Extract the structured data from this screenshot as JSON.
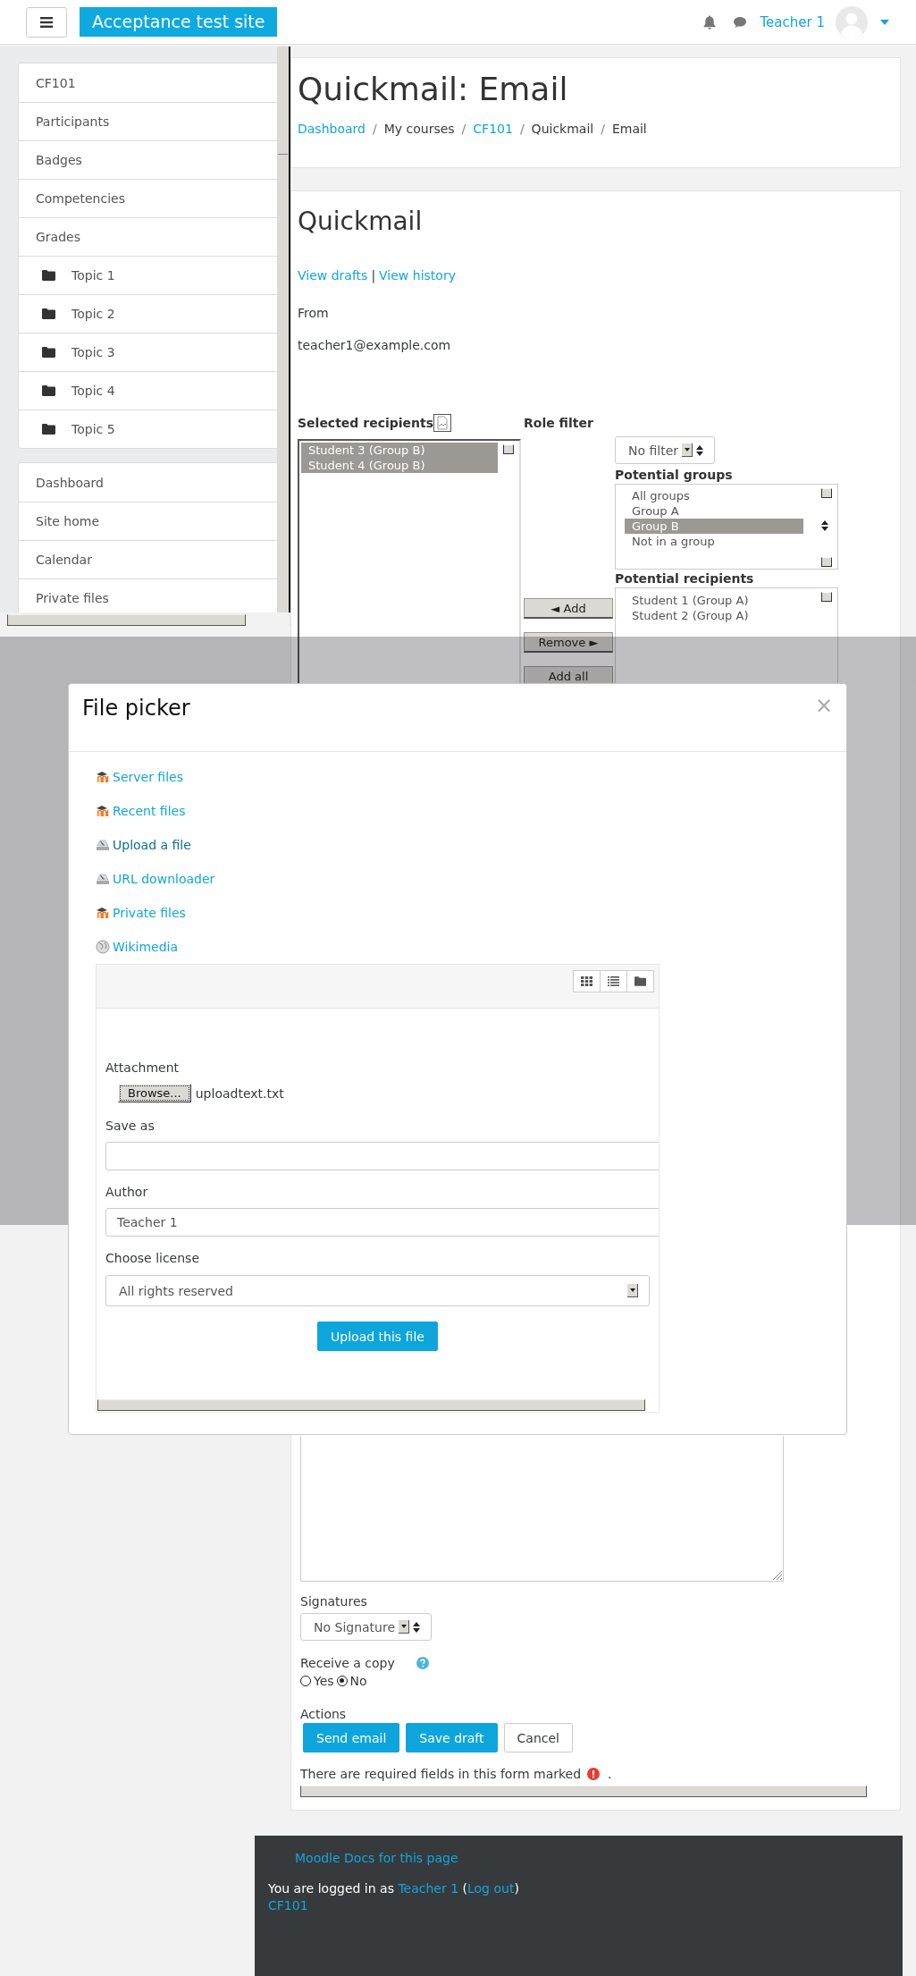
{
  "navbar": {
    "site_name": "Acceptance test site",
    "user_name": "Teacher 1"
  },
  "sidebar": {
    "sections": [
      {
        "items": [
          {
            "label": "CF101",
            "kind": "link"
          },
          {
            "label": "Participants",
            "kind": "link"
          },
          {
            "label": "Badges",
            "kind": "link"
          },
          {
            "label": "Competencies",
            "kind": "link"
          },
          {
            "label": "Grades",
            "kind": "link"
          },
          {
            "label": "Topic 1",
            "kind": "folder"
          },
          {
            "label": "Topic 2",
            "kind": "folder"
          },
          {
            "label": "Topic 3",
            "kind": "folder"
          },
          {
            "label": "Topic 4",
            "kind": "folder"
          },
          {
            "label": "Topic 5",
            "kind": "folder"
          }
        ]
      },
      {
        "items": [
          {
            "label": "Dashboard",
            "kind": "link"
          },
          {
            "label": "Site home",
            "kind": "link"
          },
          {
            "label": "Calendar",
            "kind": "link"
          },
          {
            "label": "Private files",
            "kind": "link"
          }
        ]
      }
    ]
  },
  "header": {
    "title": "Quickmail: Email",
    "breadcrumb": [
      {
        "label": "Dashboard",
        "link": true
      },
      {
        "label": "My courses",
        "link": false
      },
      {
        "label": "CF101",
        "link": true
      },
      {
        "label": "Quickmail",
        "link": false
      },
      {
        "label": "Email",
        "link": false
      }
    ],
    "separator": "/"
  },
  "form": {
    "title": "Quickmail",
    "links": [
      "View drafts",
      "View history"
    ],
    "link_separator": "|",
    "from_label": "From",
    "from_value": "teacher1@example.com",
    "selected_recipients": {
      "label": "Selected recipients",
      "items": [
        {
          "label": "Student 3 (Group B)",
          "selected": true
        },
        {
          "label": "Student 4 (Group B)",
          "selected": true
        }
      ]
    },
    "role_filter": {
      "label": "Role filter",
      "value": "No filter"
    },
    "potential_groups": {
      "label": "Potential groups",
      "items": [
        {
          "label": "All groups",
          "selected": false
        },
        {
          "label": "Group A",
          "selected": false
        },
        {
          "label": "Group B",
          "selected": true
        },
        {
          "label": "Not in a group",
          "selected": false
        }
      ]
    },
    "potential_recipients": {
      "label": "Potential recipients",
      "items": [
        {
          "label": "Student 1 (Group A)",
          "selected": false
        },
        {
          "label": "Student 2 (Group A)",
          "selected": false
        }
      ]
    },
    "move_buttons": [
      "◄ Add",
      "Remove ►",
      "Add all"
    ],
    "signatures": {
      "label": "Signatures",
      "value": "No Signature"
    },
    "receive_copy": {
      "label": "Receive a copy",
      "options": [
        {
          "label": "Yes",
          "selected": false
        },
        {
          "label": "No",
          "selected": true
        }
      ]
    },
    "actions": {
      "label": "Actions",
      "buttons": [
        {
          "label": "Send email",
          "kind": "primary"
        },
        {
          "label": "Save draft",
          "kind": "primary"
        },
        {
          "label": "Cancel",
          "kind": "secondary"
        }
      ]
    },
    "required_note": "There are required fields in this form marked",
    "required_note_end": "."
  },
  "file_picker": {
    "title": "File picker",
    "close": "×",
    "repositories": [
      {
        "label": "Server files",
        "kind": "moodle",
        "selected": false
      },
      {
        "label": "Recent files",
        "kind": "moodle",
        "selected": false
      },
      {
        "label": "Upload a file",
        "kind": "upload",
        "selected": true
      },
      {
        "label": "URL downloader",
        "kind": "upload",
        "selected": false
      },
      {
        "label": "Private files",
        "kind": "moodle",
        "selected": false
      },
      {
        "label": "Wikimedia",
        "kind": "globe",
        "selected": false
      }
    ],
    "attachment_label": "Attachment",
    "browse_button": "Browse...",
    "file_name": "uploadtext.txt",
    "save_as_label": "Save as",
    "author_label": "Author",
    "author_value": "Teacher 1",
    "license_label": "Choose license",
    "license_value": "All rights reserved",
    "upload_button": "Upload this file"
  },
  "footer": {
    "docs_link": "Moodle Docs for this page",
    "login_parts": [
      {
        "text": "You are logged in as ",
        "link": false
      },
      {
        "text": "Teacher 1",
        "link": true
      },
      {
        "text": " (",
        "link": false
      },
      {
        "text": "Log out",
        "link": true
      },
      {
        "text": ")",
        "link": false
      }
    ],
    "course_link": "CF101"
  }
}
